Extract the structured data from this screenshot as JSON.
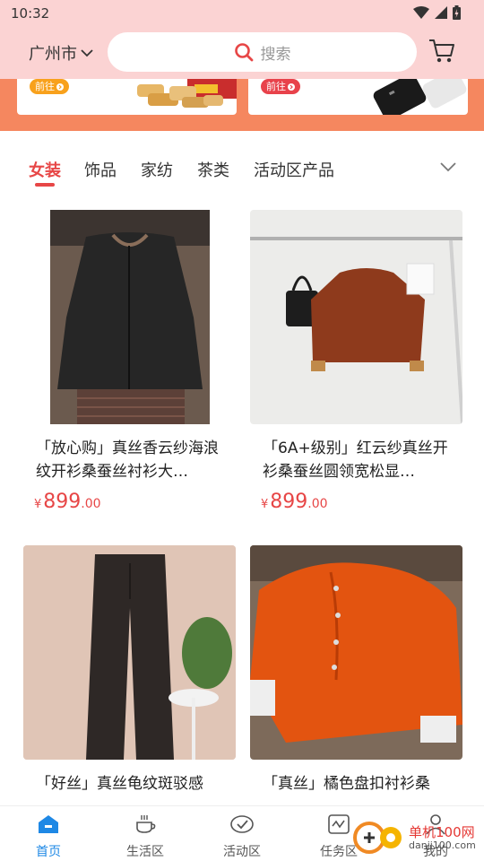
{
  "status": {
    "time": "10:32"
  },
  "header": {
    "city": "广州市",
    "search_placeholder": "搜索"
  },
  "banners": [
    {
      "button": "前往"
    },
    {
      "button": "前往"
    }
  ],
  "tabs": [
    {
      "label": "女装",
      "active": true
    },
    {
      "label": "饰品",
      "active": false
    },
    {
      "label": "家纺",
      "active": false
    },
    {
      "label": "茶类",
      "active": false
    },
    {
      "label": "活动区产品",
      "active": false
    }
  ],
  "products": [
    {
      "title": "「放心购」真丝香云纱海浪纹开衫桑蚕丝衬衫大…",
      "price_symbol": "¥",
      "price_int": "899",
      "price_dec": ".00"
    },
    {
      "title": "「6A+级别」红云纱真丝开衫桑蚕丝圆领宽松显…",
      "price_symbol": "¥",
      "price_int": "899",
      "price_dec": ".00"
    },
    {
      "title": "「好丝」真丝龟纹斑驳感",
      "price_symbol": "",
      "price_int": "",
      "price_dec": ""
    },
    {
      "title": "「真丝」橘色盘扣衬衫桑",
      "price_symbol": "",
      "price_int": "",
      "price_dec": ""
    }
  ],
  "bottom_nav": [
    {
      "label": "首页",
      "icon": "home-icon",
      "active": true
    },
    {
      "label": "生活区",
      "icon": "coffee-icon",
      "active": false
    },
    {
      "label": "活动区",
      "icon": "check-badge-icon",
      "active": false
    },
    {
      "label": "任务区",
      "icon": "task-icon",
      "active": false
    },
    {
      "label": "我的",
      "icon": "user-icon",
      "active": false
    }
  ],
  "watermark": {
    "title": "单机100网",
    "sub": "danji100.com"
  },
  "colors": {
    "header_bg": "#fbd3d3",
    "accent": "#e74646",
    "nav_active": "#1e88e5",
    "banner_bg": "#f5875f"
  }
}
